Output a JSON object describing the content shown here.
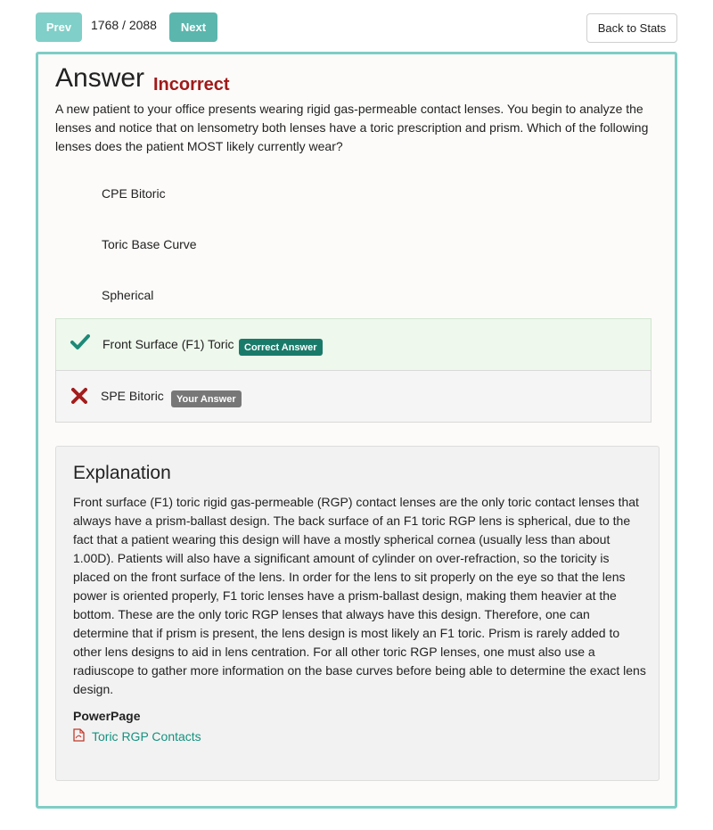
{
  "nav": {
    "prev_label": "Prev",
    "counter": "1768 / 2088",
    "next_label": "Next",
    "back_label": "Back to Stats"
  },
  "answer": {
    "heading": "Answer",
    "result": "Incorrect",
    "question": "A new patient to your office presents wearing rigid gas-permeable contact lenses. You begin to analyze the lenses and notice that on lensometry both lenses have a toric prescription and prism. Which of the following lenses does the patient MOST likely currently wear?"
  },
  "choices": [
    {
      "label": "CPE Bitoric"
    },
    {
      "label": "Toric Base Curve"
    },
    {
      "label": "Spherical"
    },
    {
      "label": "Front Surface (F1) Toric",
      "badge": "Correct Answer",
      "icon": "check-icon"
    },
    {
      "label": "SPE Bitoric",
      "badge": "Your Answer",
      "icon": "x-icon"
    }
  ],
  "explanation": {
    "title": "Explanation",
    "text": "Front surface (F1) toric rigid gas-permeable (RGP) contact lenses are the only toric contact lenses that always have a prism-ballast design. The back surface of an F1 toric RGP lens is spherical, due to the fact that a patient wearing this design will have a mostly spherical cornea (usually less than about 1.00D). Patients will also have a significant amount of cylinder on over-refraction, so the toricity is placed on the front surface of the lens. In order for the lens to sit properly on the eye so that the lens power is oriented properly, F1 toric lenses have a prism-ballast design, making them heavier at the bottom. These are the only toric RGP lenses that always have this design. Therefore, one can determine that if prism is present, the lens design is most likely an F1 toric. Prism is rarely added to other lens designs to aid in lens centration. For all other toric RGP lenses, one must also use a radiuscope to gather more information on the base curves before being able to determine the exact lens design.",
    "powerpage_label": "PowerPage",
    "powerpage_link": "Toric RGP Contacts",
    "link_icon": "pdf-icon"
  },
  "colors": {
    "accent": "#7fcdc6",
    "incorrect": "#a01a1a",
    "correct_badge": "#1a7a6a",
    "your_badge": "#777777",
    "check": "#1d8a78",
    "x": "#a41c1c",
    "link": "#14927f"
  }
}
